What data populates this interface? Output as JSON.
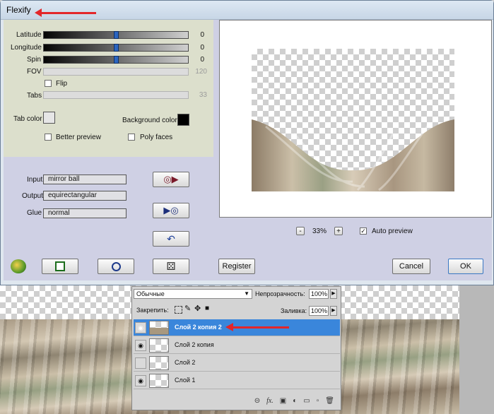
{
  "dialog": {
    "title": "Flexify",
    "sliders": [
      {
        "label": "Latitude",
        "value": "0",
        "fraction": 0.5,
        "enabled": true
      },
      {
        "label": "Longitude",
        "value": "0",
        "fraction": 0.5,
        "enabled": true
      },
      {
        "label": "Spin",
        "value": "0",
        "fraction": 0.5,
        "enabled": true
      },
      {
        "label": "FOV",
        "value": "120",
        "fraction": 1.0,
        "enabled": false
      }
    ],
    "flip_label": "Flip",
    "tabs": {
      "label": "Tabs",
      "value": "33"
    },
    "tab_color_label": "Tab color",
    "tab_color": "#e6e6e6",
    "background_color_label": "Background color",
    "background_color": "#000000",
    "better_preview_label": "Better preview",
    "poly_faces_label": "Poly faces",
    "input": {
      "label": "Input",
      "value": "mirror ball"
    },
    "output": {
      "label": "Output",
      "value": "equirectangular"
    },
    "glue": {
      "label": "Glue",
      "value": "normal"
    },
    "zoom": "33%",
    "zoom_minus": "-",
    "zoom_plus": "+",
    "auto_preview_label": "Auto preview",
    "auto_preview_checked": "✓",
    "register_label": "Register",
    "cancel_label": "Cancel",
    "ok_label": "OK"
  },
  "layers_panel": {
    "blend_mode": "Обычные",
    "opacity_label": "Непрозрачность:",
    "opacity_value": "100%",
    "lock_label": "Закрепить:",
    "fill_label": "Заливка:",
    "fill_value": "100%",
    "layers": [
      {
        "name": "Слой 2 копия 2",
        "visible": true,
        "selected": true
      },
      {
        "name": "Слой 2 копия",
        "visible": true,
        "selected": false
      },
      {
        "name": "Слой 2",
        "visible": false,
        "selected": false
      },
      {
        "name": "Слой 1",
        "visible": true,
        "selected": false
      }
    ]
  },
  "colors": {
    "selection": "#3a86db",
    "annotation_arrow": "#e3262a"
  }
}
